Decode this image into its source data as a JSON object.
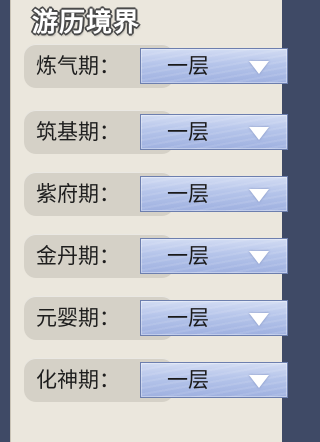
{
  "title": "游历境界",
  "realms": [
    {
      "label": "炼气期：",
      "value": "一层"
    },
    {
      "label": "筑基期：",
      "value": "一层"
    },
    {
      "label": "紫府期：",
      "value": "一层"
    },
    {
      "label": "金丹期：",
      "value": "一层"
    },
    {
      "label": "元婴期：",
      "value": "一层"
    },
    {
      "label": "化神期：",
      "value": "一层"
    }
  ],
  "colors": {
    "panel_bg": "#ebe7dd",
    "label_pill": "#d5d1c7",
    "select_blue": "#b5c4ea",
    "frame": "#3f4a66"
  }
}
